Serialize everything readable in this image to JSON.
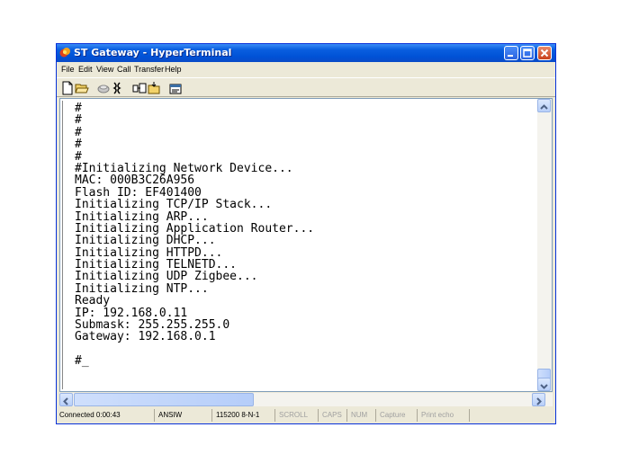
{
  "window": {
    "title": "ST Gateway - HyperTerminal"
  },
  "menu": {
    "items": [
      "File",
      "Edit",
      "View",
      "Call",
      "Transfer",
      "Help"
    ]
  },
  "toolbar": {
    "buttons": [
      "new-icon",
      "open-icon",
      "disconnect-icon",
      "call-icon",
      "send-icon",
      "receive-icon",
      "properties-icon"
    ]
  },
  "terminal": {
    "lines": [
      "#",
      "#",
      "#",
      "#",
      "#",
      "#Initializing Network Device...",
      "MAC: 000B3C26A956",
      "Flash ID: EF401400",
      "Initializing TCP/IP Stack...",
      "Initializing ARP...",
      "Initializing Application Router...",
      "Initializing DHCP...",
      "Initializing HTTPD...",
      "Initializing TELNETD...",
      "Initializing UDP Zigbee...",
      "Initializing NTP...",
      "Ready",
      "IP: 192.168.0.11",
      "Submask: 255.255.255.0",
      "Gateway: 192.168.0.1",
      "",
      "#_"
    ]
  },
  "status": {
    "connected": "Connected 0:00:43",
    "emulation": "ANSIW",
    "port_settings": "115200 8-N-1",
    "scroll": "SCROLL",
    "caps": "CAPS",
    "num": "NUM",
    "capture": "Capture",
    "print_echo": "Print echo"
  },
  "colors": {
    "titlebar": "#0a5fe0",
    "window_frame": "#ece9d8",
    "terminal_bg": "#ffffff"
  }
}
